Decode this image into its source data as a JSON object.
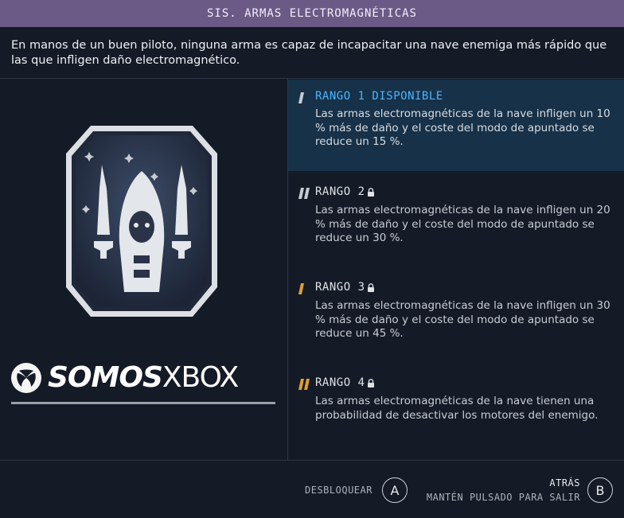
{
  "header": {
    "title": "SIS. ARMAS ELECTROMAGNÉTICAS"
  },
  "intro": "En manos de un buen piloto, ninguna arma es capaz de incapacitar una nave enemiga más rápido que las que infligen daño electromagnético.",
  "watermark": {
    "somos": "SOMOS",
    "xbox": "XBOX"
  },
  "ranks": [
    {
      "title": "RANGO 1 DISPONIBLE",
      "desc": "Las armas electromagnéticas de la nave infligen un 10 % más de daño y el coste del modo de apuntado se reduce un 15 %.",
      "locked": false
    },
    {
      "title": "RANGO 2",
      "desc": "Las armas electromagnéticas de la nave infligen un 20 % más de daño y el coste del modo de apuntado se reduce un 30 %.",
      "locked": true
    },
    {
      "title": "RANGO 3",
      "desc": "Las armas electromagnéticas de la nave infligen un 30 % más de daño y el coste del modo de apuntado se reduce un 45 %.",
      "locked": true
    },
    {
      "title": "RANGO 4",
      "desc": "Las armas electromagnéticas de la nave tienen una probabilidad de desactivar los motores del enemigo.",
      "locked": true
    }
  ],
  "footer": {
    "unlock_label": "DESBLOQUEAR",
    "unlock_key": "A",
    "back_label": "ATRÁS",
    "hold_label": "MANTÉN PULSADO PARA SALIR",
    "back_key": "B"
  },
  "colors": {
    "title_bar": "#6b5a86",
    "active_rank_bg": "#163148",
    "active_title": "#4fb3ff",
    "rank_mark_gray": "#c8ccd2",
    "rank_mark_orange": "#e0a030"
  }
}
